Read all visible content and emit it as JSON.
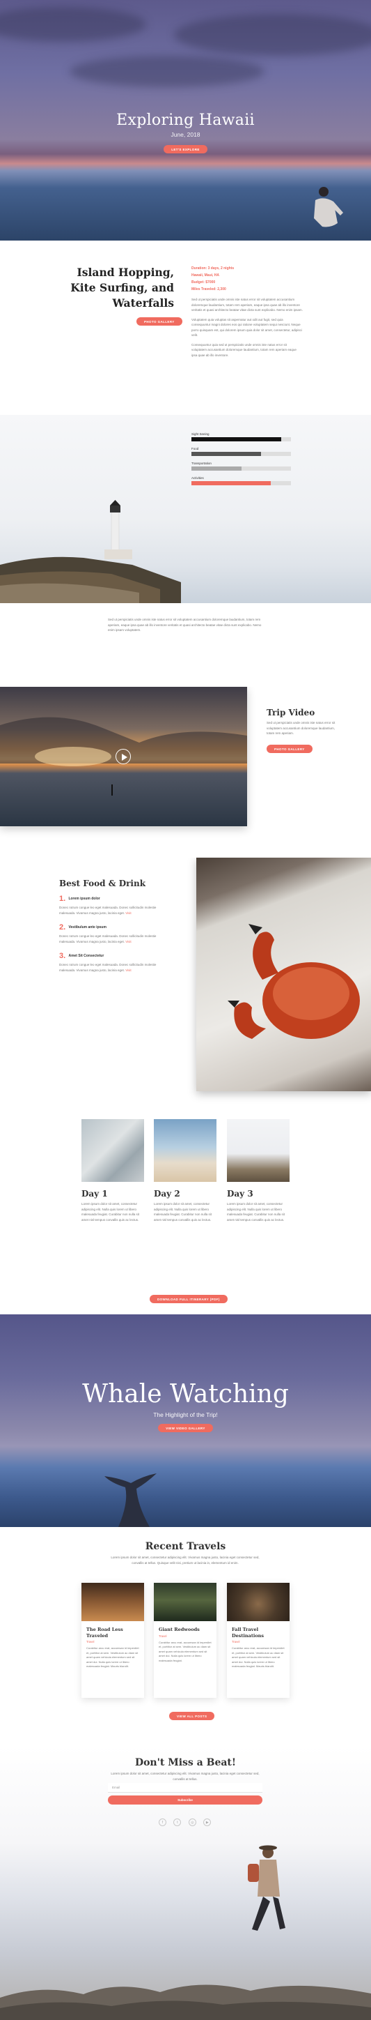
{
  "colors": {
    "accent": "#f06b5f",
    "heading": "#222222",
    "text": "#777777"
  },
  "hero": {
    "title": "Exploring Hawaii",
    "subtitle": "June, 2018",
    "button": "Let's Explore"
  },
  "intro": {
    "title": "Island Hopping, Kite Surfing, and Waterfalls",
    "button": "Photo Gallery",
    "details": [
      "Duration: 3 days, 2 nights",
      "Hawaii, Maui, HA",
      "Budget: $7000",
      "Miles Traveled: 2,300"
    ],
    "paragraphs": [
      "Sed ut perspiciatis unde omnis iste natus error sit voluptatem accusantium doloremque laudantium, totam rem aperiam, eaque ipsa quae ab illo inventore veritatis et quasi architecto beatae vitae dicta sunt explicabo. Nemo enim ipsam.",
      "Voluptatem quia voluptas sit aspernatur aut odit aut fugit, sed quia consequuntur magni dolores eos qui ratione voluptatem sequi nesciunt. Neque porro quisquam est, qui dolorem ipsum quia dolor sit amet, consectetur, adipisci velit.",
      "Consequuntur quia sed ut perspiciatis unde omnis iste natus error sit voluptatem accusantium doloremque laudantium, totam rem aperiam eaque ipsa quae ab illo inventore."
    ]
  },
  "budget": {
    "bars": [
      {
        "label": "Sight Seeing",
        "value": 0.9,
        "color": "#111111"
      },
      {
        "label": "Food",
        "value": 0.7,
        "color": "#555555"
      },
      {
        "label": "Transportation",
        "value": 0.5,
        "color": "#aaaaaa"
      },
      {
        "label": "Activities",
        "value": 0.8,
        "color": "#f06b5f"
      }
    ]
  },
  "info": {
    "text": "Sed ut perspiciatis unde omnis iste natus error sit voluptatem accusantium doloremque laudantium, totam rem aperiam, eaque ipsa quae ab illo inventore veritatis et quasi architecto beatae vitae dicta sunt explicabo. Nemo enim ipsam voluptatem."
  },
  "video": {
    "title": "Trip Video",
    "text": "Sed ut perspiciatis unde omnis iste natus error sit voluptatem accusantium doloremque laudantium, totam rem aperiam.",
    "button": "Photo Gallery"
  },
  "food": {
    "title": "Best Food & Drink",
    "items": [
      {
        "num": "1.",
        "title": "Lorem ipsum dolor",
        "text": "Donec rutrum congue leo eget malesuada. Donec sollicitudin molestie malesuada. Vivamus magna justo, lacinia eget.",
        "more": "Visit"
      },
      {
        "num": "2.",
        "title": "Vestibulum ante ipsum",
        "text": "Donec rutrum congue leo eget malesuada. Donec sollicitudin molestie malesuada. Vivamus magna justo, lacinia eget.",
        "more": "Visit"
      },
      {
        "num": "3.",
        "title": "Amet Sit Consectetur",
        "text": "Donec rutrum congue leo eget malesuada. Donec sollicitudin molestie malesuada. Vivamus magna justo, lacinia eget.",
        "more": "Visit"
      }
    ]
  },
  "days": {
    "items": [
      {
        "title": "Day 1",
        "text": "Lorem ipsum dolor sit amet, consectetur adipiscing elit. Nulla quis lorem ut libero malesuada feugiat. Curabitur non nulla sit amet nisl tempus convallis quis ac lectus."
      },
      {
        "title": "Day 2",
        "text": "Lorem ipsum dolor sit amet, consectetur adipiscing elit. Nulla quis lorem ut libero malesuada feugiat. Curabitur non nulla sit amet nisl tempus convallis quis ac lectus."
      },
      {
        "title": "Day 3",
        "text": "Lorem ipsum dolor sit amet, consectetur adipiscing elit. Nulla quis lorem ut libero malesuada feugiat. Curabitur non nulla sit amet nisl tempus convallis quis ac lectus."
      }
    ],
    "button": "Download Full Itinerary (PDF)"
  },
  "whale": {
    "title": "Whale Watching",
    "subtitle": "The Highlight of the Trip!",
    "button": "View Video Gallery"
  },
  "recent": {
    "title": "Recent Travels",
    "intro": "Lorem ipsum dolor sit amet, consectetur adipiscing elit. Vivamus magna justo, lacinia eget consectetur sed, convallis at tellus. Quisque velit nisi, pretium ut lacinia in, elementum id enim.",
    "cards": [
      {
        "title": "The Road Less Traveled",
        "category": "Travel",
        "text": "Curabitur arcu erat, accumsan id imperdiet et, porttitor at sem. Vestibulum ac diam sit amet quam vehicula elementum sed sit amet dui. Nulla quis lorem ut libero malesuada feugiat. Mauris blandit."
      },
      {
        "title": "Giant Redwoods",
        "category": "Travel",
        "text": "Curabitur arcu erat, accumsan id imperdiet et, porttitor at sem. Vestibulum ac diam sit amet quam vehicula elementum sed sit amet dui. Nulla quis lorem ut libero malesuada feugiat."
      },
      {
        "title": "Fall Travel Destinations",
        "category": "Travel",
        "text": "Curabitur arcu erat, accumsan id imperdiet et, porttitor at sem. Vestibulum ac diam sit amet quam vehicula elementum sed sit amet dui. Nulla quis lorem ut libero malesuada feugiat. Mauris blandit."
      }
    ],
    "button": "View All Posts"
  },
  "newsletter": {
    "title": "Don't Miss a Beat!",
    "intro": "Lorem ipsum dolor sit amet, consectetur adipiscing elit. Vivamus magna justo, lacinia eget consectetur sed, convallis at tellus.",
    "email_placeholder": "Email",
    "button": "Subscribe",
    "socials": [
      {
        "icon": "facebook-icon",
        "glyph": "f"
      },
      {
        "icon": "twitter-icon",
        "glyph": "t"
      },
      {
        "icon": "instagram-icon",
        "glyph": "◎"
      },
      {
        "icon": "youtube-icon",
        "glyph": "▶"
      }
    ]
  }
}
